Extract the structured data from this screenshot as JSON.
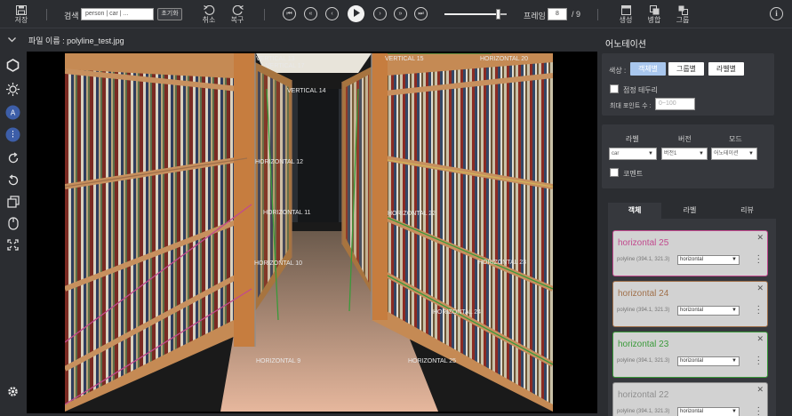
{
  "toolbar": {
    "save_label": "저장",
    "search_label": "검색",
    "search_placeholder": "person | car | ...",
    "reset_label": "초기화",
    "undo_label": "취소",
    "redo_label": "복구",
    "frame_label": "프레임",
    "frame_value": "8",
    "frame_separator": "/",
    "frame_total": "9",
    "slider_value": 0.86,
    "create_label": "생성",
    "merge_label": "병합",
    "group_label": "그룹"
  },
  "file": {
    "name_label": "파일 이름 : polyline_test.jpg"
  },
  "annotations": [
    {
      "text": "VERTICAL 13"
    },
    {
      "text": "VERTICAL 17"
    },
    {
      "text": "VERTICAL 14"
    },
    {
      "text": "VERTICAL 15"
    },
    {
      "text": "HORIZONTAL 20"
    },
    {
      "text": "HORIZONTAL 12"
    },
    {
      "text": "HORIZONTAL 11"
    },
    {
      "text": "HORIZONTAL 22"
    },
    {
      "text": "HORIZONTAL 10"
    },
    {
      "text": "HORIZONTAL 23"
    },
    {
      "text": "HORIZONTAL 24"
    },
    {
      "text": "HORIZONTAL 9"
    },
    {
      "text": "HORIZONTAL 25"
    }
  ],
  "panel": {
    "title": "어노테이션",
    "color_label": "색상 :",
    "color_btn_object": "객체별",
    "color_btn_group": "그룹별",
    "color_btn_label": "라벨별",
    "show_border_label": "점정 테두리",
    "max_points_label": "최대 포인트 수 :",
    "max_points_placeholder": "0~100",
    "col_label": "라벨",
    "col_version": "버전",
    "col_mode": "모드",
    "label_value": "car",
    "version_value": "버전1",
    "mode_value": "어노테이션",
    "comment_label": "코멘트",
    "tabs": [
      {
        "label": "객체"
      },
      {
        "label": "라벨"
      },
      {
        "label": "리뷰"
      }
    ],
    "cards": [
      {
        "title": "horizontal 25",
        "sub": "polyline (394.1, 321.3)",
        "select": "horizontal",
        "color": "#c24a8e"
      },
      {
        "title": "horizontal 24",
        "sub": "polyline (394.1, 321.3)",
        "select": "horizontal",
        "color": "#a0704a"
      },
      {
        "title": "horizontal 23",
        "sub": "polyline (394.1, 321.3)",
        "select": "horizontal",
        "color": "#3a9a3a"
      },
      {
        "title": "horizontal 22",
        "sub": "polyline (394.1, 321.3)",
        "select": "horizontal",
        "color": "#8e8e8e"
      }
    ]
  },
  "icons": [
    "save-icon",
    "undo-icon",
    "redo-icon",
    "skip-start-icon",
    "fast-back-icon",
    "step-back-icon",
    "play-icon",
    "step-forward-icon",
    "fast-forward-icon",
    "skip-end-icon",
    "create-icon",
    "merge-icon",
    "group-icon",
    "info-icon",
    "chevron-down-icon",
    "polygon-tool-icon",
    "brightness-icon",
    "auto-label-icon",
    "magic-icon",
    "rotate-cw-icon",
    "rotate-ccw-icon",
    "layers-icon",
    "mouse-icon",
    "fit-screen-icon",
    "settings-icon",
    "close-icon",
    "more-icon"
  ]
}
